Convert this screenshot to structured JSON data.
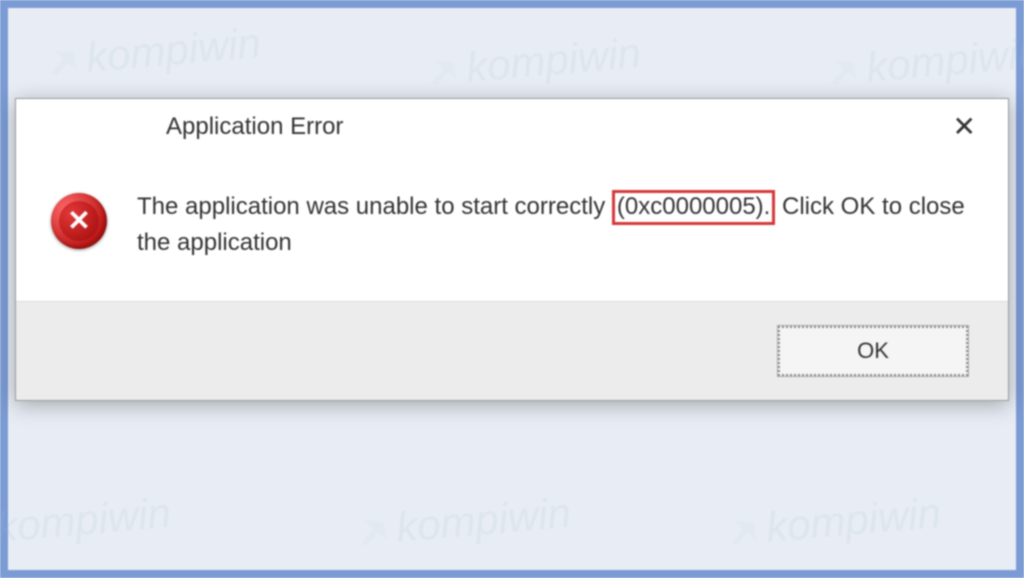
{
  "watermark": {
    "text": "kompiwin"
  },
  "dialog": {
    "title": "Application Error",
    "message_part1": "The application was unable to start correctly ",
    "error_code": "(0xc0000005).",
    "message_part2": " Click OK to close the application",
    "ok_button_label": "OK"
  }
}
